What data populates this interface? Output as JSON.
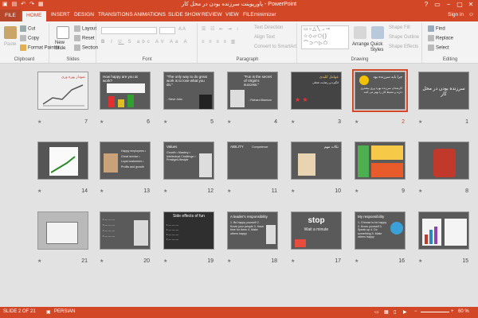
{
  "window": {
    "title": "پاورپوینت سرزنده بودن در محل کار - PowerPoint",
    "controls": [
      "?",
      "▭",
      "−",
      "▢",
      "✕"
    ]
  },
  "tabs": [
    "FILE",
    "HOME",
    "INSERT",
    "DESIGN",
    "TRANSITIONS",
    "ANIMATIONS",
    "SLIDE SHOW",
    "REVIEW",
    "VIEW",
    "FILEminimizer"
  ],
  "active_tab": "HOME",
  "signin": "Sign in",
  "ribbon": {
    "clipboard": {
      "label": "Clipboard",
      "paste": "Paste",
      "cut": "Cut",
      "copy": "Copy",
      "format_painter": "Format Painter"
    },
    "slides": {
      "label": "Slides",
      "new_slide": "New Slide",
      "layout": "Layout",
      "reset": "Reset",
      "section": "Section"
    },
    "font": {
      "label": "Font"
    },
    "paragraph": {
      "label": "Paragraph",
      "text_direction": "Text Direction",
      "align_text": "Align Text",
      "convert_smartart": "Convert to SmartArt"
    },
    "drawing": {
      "label": "Drawing",
      "arrange": "Arrange",
      "quick_styles": "Quick Styles",
      "shape_fill": "Shape Fill",
      "shape_outline": "Shape Outline",
      "shape_effects": "Shape Effects"
    },
    "editing": {
      "label": "Editing",
      "find": "Find",
      "replace": "Replace",
      "select": "Select"
    }
  },
  "slides": [
    {
      "n": "1",
      "title": "سرزنده بودن در محل کار",
      "body": ""
    },
    {
      "n": "2",
      "title": "چرا باید سرزنده بود",
      "body": "کارمندان سرزنده بهره وری بیشتری دارند و محیط کار را بهتر می کنند"
    },
    {
      "n": "3",
      "title": "عوامل کلیدی",
      "body": "انگیزه و رضایت شغلی"
    },
    {
      "n": "4",
      "title": "\"Fun is the secret of Virgin's success.\"",
      "body": "- Richard Branson"
    },
    {
      "n": "5",
      "title": "\"The only way to do great work is to love what you do.\"",
      "body": "- Steve Jobs"
    },
    {
      "n": "6",
      "title": "How happy are you at work?",
      "body": ""
    },
    {
      "n": "7",
      "title": "نمودار بهره وری",
      "body": ""
    },
    {
      "n": "8",
      "title": "",
      "body": ""
    },
    {
      "n": "9",
      "title": "",
      "body": ""
    },
    {
      "n": "10",
      "title": "نکات مهم",
      "body": ""
    },
    {
      "n": "11",
      "title": "ABILITY",
      "body": "Competence"
    },
    {
      "n": "12",
      "title": "Values",
      "body": "Growth • Mastery • Intellectual Challenge • Prestige/Lifestyle"
    },
    {
      "n": "13",
      "title": "",
      "body": "Happy employees • Great service • Loyal customers • Profits and growth"
    },
    {
      "n": "14",
      "title": "",
      "body": ""
    },
    {
      "n": "15",
      "title": "",
      "body": ""
    },
    {
      "n": "16",
      "title": "My responsibility",
      "body": "1. Choose to be happy 2. Know yourself 3. Speak up 4. Do something 5. Make others happy"
    },
    {
      "n": "17",
      "title": "stop",
      "body": "Wait a minute"
    },
    {
      "n": "18",
      "title": "A leader's responsibility",
      "body": "1. Be happy yourself 2. Know your people 3. Have time for them 4. Make others happy"
    },
    {
      "n": "19",
      "title": "Side effects of fun",
      "body": ""
    },
    {
      "n": "20",
      "title": "",
      "body": ""
    },
    {
      "n": "21",
      "title": "",
      "body": ""
    }
  ],
  "selected_slide": "2",
  "star": "★",
  "status": {
    "slide": "SLIDE 2 OF 21",
    "language": "PERSIAN",
    "zoom": "60 %"
  },
  "colors": {
    "accent": "#d24726",
    "ribbon": "#f3f3f3",
    "sorter": "#e2e2e2"
  }
}
